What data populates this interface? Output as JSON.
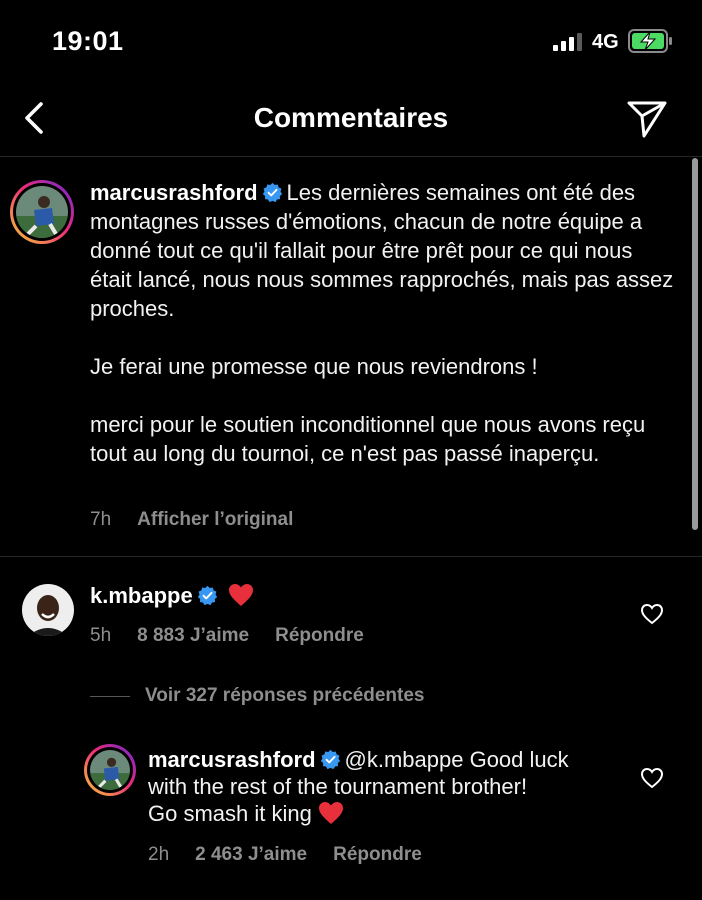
{
  "status_bar": {
    "time": "19:01",
    "network": "4G",
    "signal_icon": "signal-bars-icon",
    "battery_icon": "battery-charging-icon",
    "battery_color": "#4cd964"
  },
  "nav": {
    "title": "Commentaires",
    "back_icon": "chevron-left-icon",
    "share_icon": "paper-plane-icon"
  },
  "caption": {
    "username": "marcusrashford",
    "verified": true,
    "paragraphs": [
      "Les dernières semaines ont été des montagnes russes d'émotions, chacun de notre équipe a donné tout ce qu'il fallait pour être prêt pour ce qui nous était lancé, nous nous sommes rapprochés, mais pas assez proches.",
      "Je ferai une promesse que nous reviendrons !",
      "merci pour le soutien inconditionnel que nous avons reçu tout au long du tournoi, ce n'est pas passé inaperçu."
    ],
    "time": "7h",
    "translate_label": "Afficher l’original"
  },
  "comment": {
    "username": "k.mbappe",
    "verified": true,
    "emoji": "❤️",
    "time": "5h",
    "likes": "8 883 J’aime",
    "reply_label": "Répondre"
  },
  "view_replies_label": "Voir 327 réponses précédentes",
  "reply": {
    "username": "marcusrashford",
    "verified": true,
    "text_line1": "@k.mbappe Good luck",
    "text_line2": "with the rest of the tournament brother!",
    "text_line3": "Go smash it king",
    "emoji": "❤️",
    "time": "2h",
    "likes": "2 463 J’aime",
    "reply_label": "Répondre"
  },
  "colors": {
    "background": "#000000",
    "text": "#f2f2f2",
    "muted": "#8e8e8e",
    "verified": "#3897f0",
    "heart": "#ed4956"
  }
}
